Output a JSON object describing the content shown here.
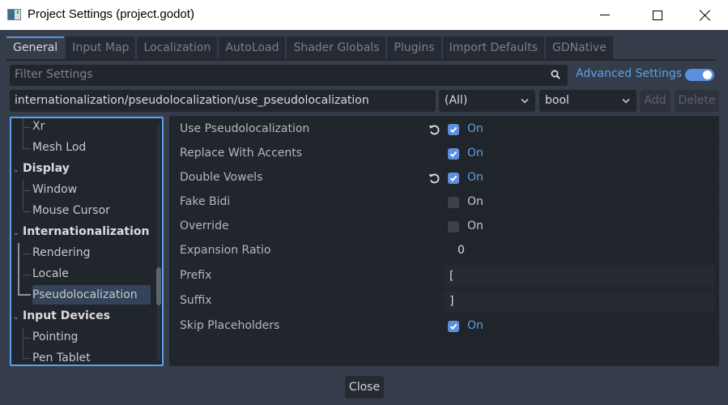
{
  "window": {
    "title": "Project Settings (project.godot)",
    "controls": [
      "minimize",
      "maximize",
      "close"
    ]
  },
  "tabs": [
    {
      "label": "General",
      "active": true
    },
    {
      "label": "Input Map",
      "active": false
    },
    {
      "label": "Localization",
      "active": false
    },
    {
      "label": "AutoLoad",
      "active": false
    },
    {
      "label": "Shader Globals",
      "active": false
    },
    {
      "label": "Plugins",
      "active": false
    },
    {
      "label": "Import Defaults",
      "active": false
    },
    {
      "label": "GDNative",
      "active": false
    }
  ],
  "filter": {
    "placeholder": "Filter Settings",
    "value": "",
    "icon": "search-icon"
  },
  "advanced_settings": {
    "label": "Advanced Settings",
    "enabled": true,
    "accent": "#5ba0e8"
  },
  "property_bar": {
    "path": "internationalization/pseudolocalization/use_pseudolocalization",
    "category": "(All)",
    "type": "bool",
    "add_label": "Add",
    "delete_label": "Delete"
  },
  "tree": {
    "items": [
      {
        "label": "Xr",
        "level": "child"
      },
      {
        "label": "Mesh Lod",
        "level": "child"
      },
      {
        "label": "Display",
        "level": "parent",
        "expanded": true
      },
      {
        "label": "Window",
        "level": "child"
      },
      {
        "label": "Mouse Cursor",
        "level": "child"
      },
      {
        "label": "Internationalization",
        "level": "parent",
        "expanded": true
      },
      {
        "label": "Rendering",
        "level": "child"
      },
      {
        "label": "Locale",
        "level": "child"
      },
      {
        "label": "Pseudolocalization",
        "level": "child",
        "selected": true
      },
      {
        "label": "Input Devices",
        "level": "parent",
        "expanded": true
      },
      {
        "label": "Pointing",
        "level": "child"
      },
      {
        "label": "Pen Tablet",
        "level": "child"
      }
    ]
  },
  "properties": [
    {
      "label": "Use Pseudolocalization",
      "kind": "bool",
      "checked": true,
      "value_label": "On",
      "revertable": true
    },
    {
      "label": "Replace With Accents",
      "kind": "bool",
      "checked": true,
      "value_label": "On",
      "revertable": false
    },
    {
      "label": "Double Vowels",
      "kind": "bool",
      "checked": true,
      "value_label": "On",
      "revertable": true
    },
    {
      "label": "Fake Bidi",
      "kind": "bool",
      "checked": false,
      "value_label": "On",
      "revertable": false
    },
    {
      "label": "Override",
      "kind": "bool",
      "checked": false,
      "value_label": "On",
      "revertable": false
    },
    {
      "label": "Expansion Ratio",
      "kind": "number",
      "value": "0"
    },
    {
      "label": "Prefix",
      "kind": "text",
      "value": "["
    },
    {
      "label": "Suffix",
      "kind": "text",
      "value": "]"
    },
    {
      "label": "Skip Placeholders",
      "kind": "bool",
      "checked": true,
      "value_label": "On",
      "revertable": false
    }
  ],
  "footer": {
    "close_label": "Close"
  }
}
